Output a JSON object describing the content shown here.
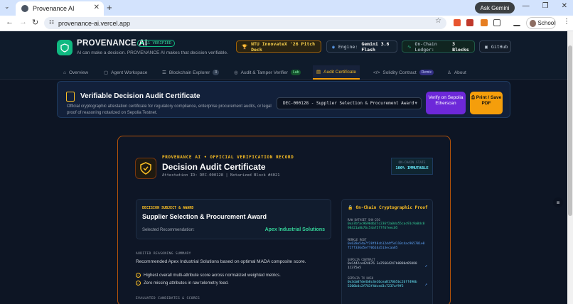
{
  "browser": {
    "tab_title": "Provenance AI",
    "url": "provenance-ai.vercel.app",
    "gemini_label": "Ask Gemini",
    "profile_label": "School"
  },
  "header": {
    "brand": "PROVENANCE AI",
    "verified_badge": "● L1 VERIFIED",
    "tagline": "AI can make a decision. PROVENANCE AI makes that decision verifiable.",
    "pitch_pill": "NTU InnovateX '26 Pitch Deck",
    "engine_label": "Engine:",
    "engine_value": "Gemini 3.6 Flash",
    "ledger_label": "On-Chain Ledger:",
    "ledger_value": "3 Blocks",
    "github_label": "GitHub"
  },
  "nav": {
    "overview": "Overview",
    "workspace": "Agent Workspace",
    "explorer": "Blockchain Explorer",
    "explorer_count": "3",
    "audit": "Audit & Tamper Verifier",
    "audit_badge": "Lab",
    "certificate": "Audit Certificate",
    "solidity": "Solidity Contract",
    "solidity_badge": "Remix",
    "about": "About"
  },
  "banner": {
    "title": "Verifiable Decision Audit Certificate",
    "description": "Official cryptographic attestation certificate for regulatory compliance, enterprise procurement audits, or legal proof of reasoning notarized on Sepolia Testnet.",
    "selected_decision": "DEC-000128 - Supplier Selection & Procurement Award",
    "verify_label": "Verify on Sepolia Etherscan",
    "print_label": "Print / Save PDF"
  },
  "certificate": {
    "kicker": "PROVENANCE AI • OFFICIAL VERIFICATION RECORD",
    "title": "Decision Audit Certificate",
    "attestation": "Attestation ID: DEC-000128 | Notarized Block #4021",
    "state_label": "ON-CHAIN STATE",
    "state_value": "100% IMMUTABLE",
    "subject_kicker": "DECISION SUBJECT & AWARD",
    "subject_title": "Supplier Selection & Procurement Award",
    "recommendation_label": "Selected Recommendation:",
    "recommendation_value": "Apex Industrial Solutions",
    "reasoning_header": "AUDITED REASONING SUMMARY",
    "summary": "Recommended Apex Industrial Solutions based on optimal MADA composite score.",
    "bullets": [
      "Highest overall multi-attribute score across normalized weighted metrics.",
      "Zero missing attributes in raw telemetry feed."
    ],
    "candidates_header": "EVALUATED CANDIDATES & SCORES"
  },
  "proof": {
    "title": "On-Chain Cryptographic Proof",
    "raw_label": "RAW DATASET SHA-256",
    "raw_value": "0xa7bfac9698db27c236f2a0da55cac91c9a0dc098421a8b76c54af5f7f6feec05",
    "merkle_label": "MERKLE ROOT",
    "merkle_value": "0x628e54a7f28f48cb12d4f5d110c4ac965701e0f2ff336d5eff0616a513ecaa85",
    "contract_label": "SEPOLIA CONTRACT",
    "contract_value": "0xC442ce424676 3e25664247b0880d050801C375e5",
    "tx_label": "SEPOLIA TX HASH",
    "tx_value": "0x3da07de4b8c4e16ceaB17065bc26ff490b5206b4c2f763f4dced3c7237af9f5"
  },
  "colors": {
    "accent": "#f59e0b",
    "success": "#34d399",
    "brand": "#10b981",
    "verify": "#6d28d9"
  }
}
